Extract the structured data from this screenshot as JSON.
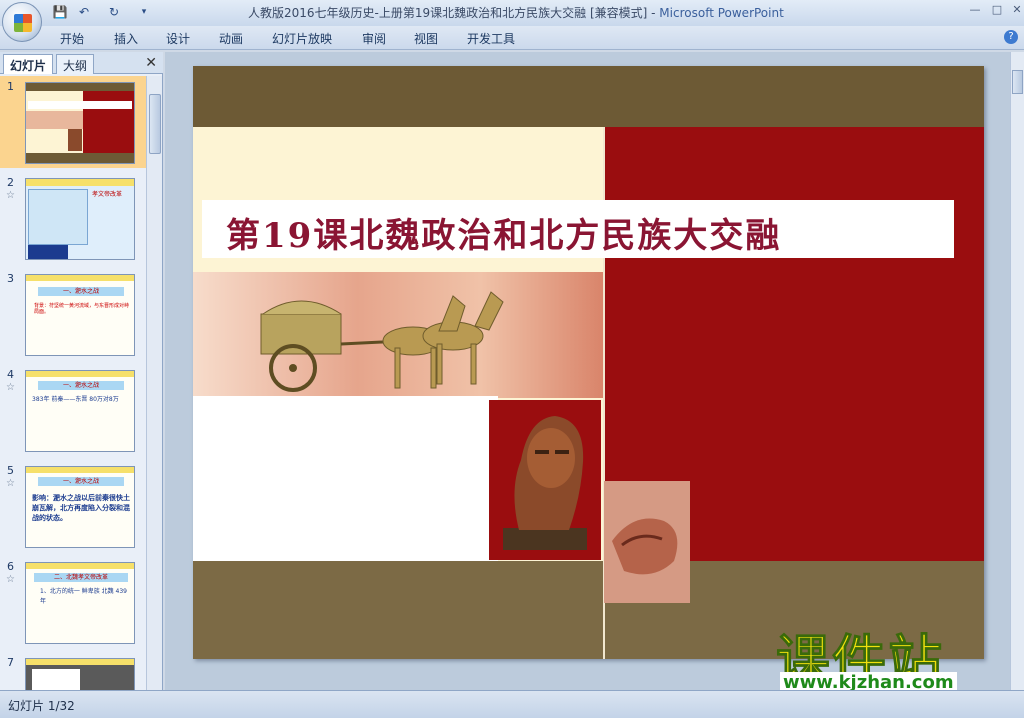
{
  "window": {
    "title": "人教版2016七年级历史-上册第19课北魏政治和北方民族大交融 [兼容模式] -",
    "app_name": "Microsoft PowerPoint"
  },
  "menu": [
    "开始",
    "插入",
    "设计",
    "动画",
    "幻灯片放映",
    "审阅",
    "视图",
    "开发工具"
  ],
  "panel": {
    "tabs": [
      "幻灯片",
      "大纲"
    ]
  },
  "thumbnails": [
    {
      "number": "1"
    },
    {
      "number": "2",
      "title": "二、北魏孝文帝改革",
      "text": "孝文帝改革"
    },
    {
      "number": "3",
      "title": "一、淝水之战",
      "text": "背景：苻坚统一黄河流域，与东晋形成对峙局面。"
    },
    {
      "number": "4",
      "title": "一、淝水之战",
      "text": "383年 前秦——东晋 80万对8万"
    },
    {
      "number": "5",
      "title": "一、淝水之战",
      "text": "影响：淝水之战以后前秦很快土崩瓦解，北方再度陷入分裂和混战的状态。"
    },
    {
      "number": "6",
      "title": "二、北魏孝文帝改革",
      "text": "1、北方的统一 鲜卑族 北魏 439年"
    },
    {
      "number": "7",
      "title": "",
      "text": ""
    }
  ],
  "slide": {
    "title": "第19课北魏政治和北方民族大交融"
  },
  "watermark": {
    "text": "课件站",
    "url": "www.kjzhan.com"
  },
  "status": {
    "slide_counter": "幻灯片 1/32"
  },
  "colors": {
    "slide_red": "#9a0d0f",
    "slide_brown": "#6d5a35",
    "title_text": "#8a1533",
    "selected_thumb": "#fbd48f"
  }
}
